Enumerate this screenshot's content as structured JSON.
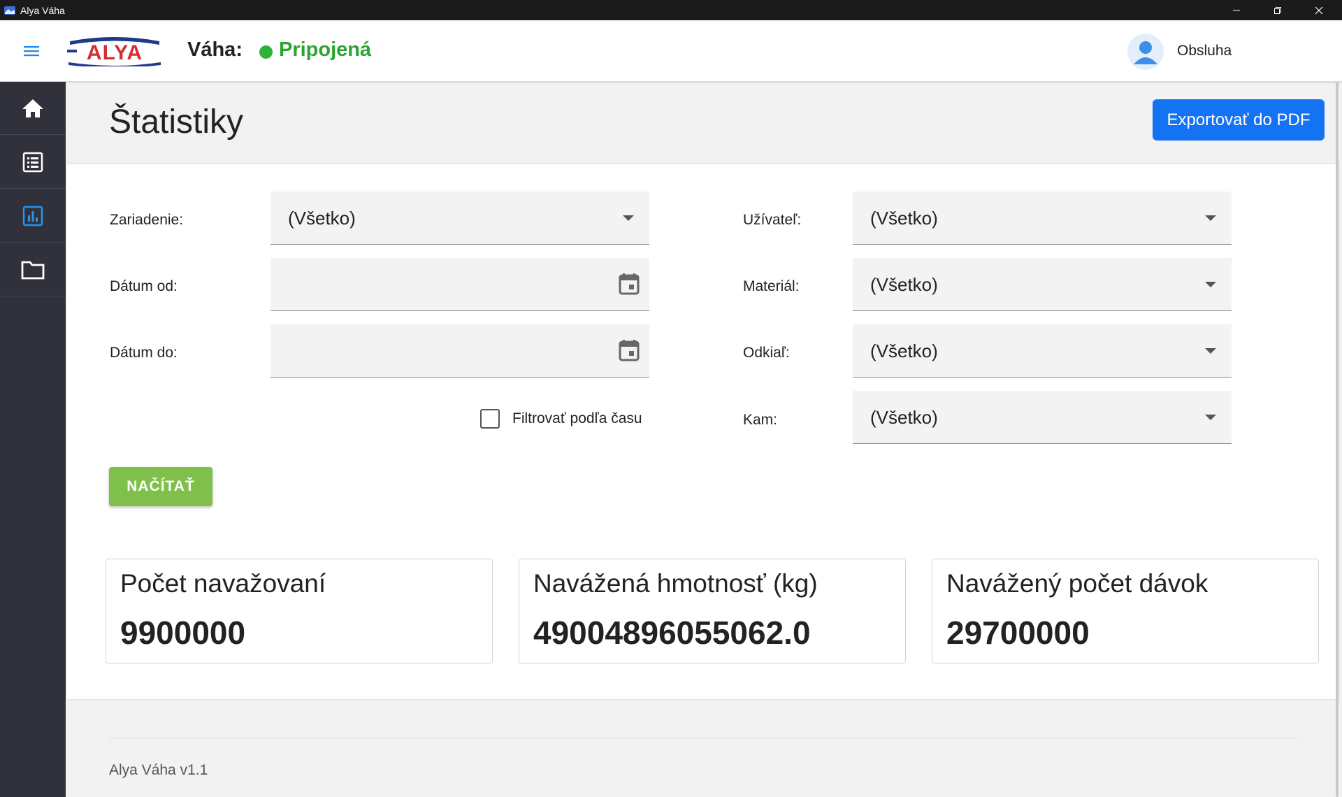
{
  "window": {
    "title": "Alya Váha",
    "controls": [
      "minimize-icon",
      "restore-icon",
      "close-icon"
    ]
  },
  "header": {
    "logo_text": "ALYA",
    "scale_label": "Váha:",
    "status": "Pripojená",
    "status_color": "#2aa52e",
    "user": "Obsluha"
  },
  "sidebar": {
    "items": [
      {
        "icon": "home-icon",
        "active": false
      },
      {
        "icon": "list-icon",
        "active": false
      },
      {
        "icon": "chart-icon",
        "active": true
      },
      {
        "icon": "folder-icon",
        "active": false
      }
    ],
    "active_color": "#2196f3"
  },
  "page": {
    "title": "Štatistiky",
    "export_label": "Exportovať do PDF"
  },
  "filters": {
    "device": {
      "label": "Zariadenie:",
      "value": "(Všetko)"
    },
    "date_from": {
      "label": "Dátum od:",
      "value": ""
    },
    "date_to": {
      "label": "Dátum do:",
      "value": ""
    },
    "time_filter": {
      "label": "Filtrovať podľa času",
      "checked": false
    },
    "user": {
      "label": "Užívateľ:",
      "value": "(Všetko)"
    },
    "material": {
      "label": "Materiál:",
      "value": "(Všetko)"
    },
    "source": {
      "label": "Odkiaľ:",
      "value": "(Všetko)"
    },
    "destination": {
      "label": "Kam:",
      "value": "(Všetko)"
    },
    "load_label": "NAČÍTAŤ"
  },
  "stats": [
    {
      "title": "Počet navažovaní",
      "value": "9900000"
    },
    {
      "title": "Navážená hmotnosť (kg)",
      "value": "49004896055062.0"
    },
    {
      "title": "Navážený počet dávok",
      "value": "29700000"
    }
  ],
  "footer": {
    "version": "Alya Váha v1.1"
  },
  "colors": {
    "primary": "#1473f2",
    "load_button": "#7fc04a",
    "sidebar_bg": "#30313a"
  }
}
